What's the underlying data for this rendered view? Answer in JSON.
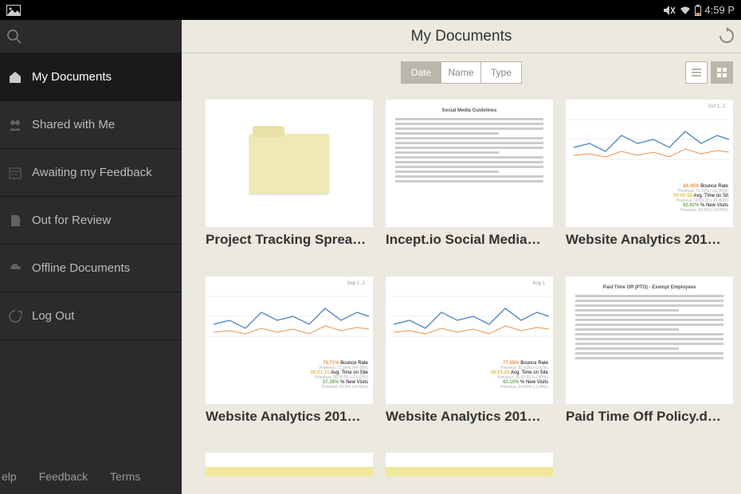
{
  "statusbar": {
    "time": "4:59 P"
  },
  "sidebar": {
    "items": [
      {
        "label": "My Documents",
        "active": true
      },
      {
        "label": "Shared with Me",
        "active": false
      },
      {
        "label": "Awaiting my Feedback",
        "active": false
      },
      {
        "label": "Out for Review",
        "active": false
      },
      {
        "label": "Offline Documents",
        "active": false
      },
      {
        "label": "Log Out",
        "active": false
      }
    ],
    "footer": {
      "help": "elp",
      "feedback": "Feedback",
      "terms": "Terms"
    }
  },
  "header": {
    "title": "My Documents"
  },
  "sort": {
    "options": [
      "Date",
      "Name",
      "Type"
    ],
    "active": "Date"
  },
  "docs": [
    {
      "title": "Project Tracking Sprea…",
      "type": "folder"
    },
    {
      "title": "Incept.io Social Media…",
      "type": "textdoc",
      "heading": "Social Media Guidelines"
    },
    {
      "title": "Website Analytics 201…",
      "type": "analytics",
      "daterange": "Oct 1, 2",
      "stats": [
        {
          "value": "84.45%",
          "label": "Bounce Rate",
          "prev": "Previous: 71.11% (+11.89%)",
          "cls": "c-orange"
        },
        {
          "value": "00:00:59",
          "label": "Avg. Time on Sit",
          "prev": "Previous: 00:01:20 (-21.80%)",
          "cls": "c-yellow"
        },
        {
          "value": "62.92%",
          "label": "% New Visits",
          "prev": "Previous: 63.5% (-14.65%)",
          "cls": "c-green"
        }
      ]
    },
    {
      "title": "Website Analytics 201…",
      "type": "analytics",
      "daterange": "Sep 1, 2",
      "stats": [
        {
          "value": "75.71%",
          "label": "Bounce Rate",
          "prev": "Previous: 71.94% (+4.08%)",
          "cls": "c-orange"
        },
        {
          "value": "00:01:15",
          "label": "Avg. Time on Site",
          "prev": "Previous: 00:00:59 (+19.02%)",
          "cls": "c-yellow"
        },
        {
          "value": "57.38%",
          "label": "% New Visits",
          "prev": "Previous: 63.5% (+4.65%)",
          "cls": "c-green"
        }
      ]
    },
    {
      "title": "Website Analytics 201…",
      "type": "analytics",
      "daterange": "Aug 1",
      "stats": [
        {
          "value": "77.55%",
          "label": "Bounce Rate",
          "prev": "Previous: 81.83% (-5.82%)",
          "cls": "c-orange"
        },
        {
          "value": "00:01:00",
          "label": "Avg. Time on Site",
          "prev": "Previous: 00:00:50 (+7.82%)",
          "cls": "c-yellow"
        },
        {
          "value": "63.10%",
          "label": "% New Visits",
          "prev": "Previous: 64.56% (-3.49%)",
          "cls": "c-green"
        }
      ]
    },
    {
      "title": "Paid Time Off Policy.d…",
      "type": "textdoc",
      "heading": "Paid Time Off (PTO) - Exempt Employees"
    },
    {
      "title": "",
      "type": "partial"
    },
    {
      "title": "",
      "type": "partial"
    }
  ]
}
